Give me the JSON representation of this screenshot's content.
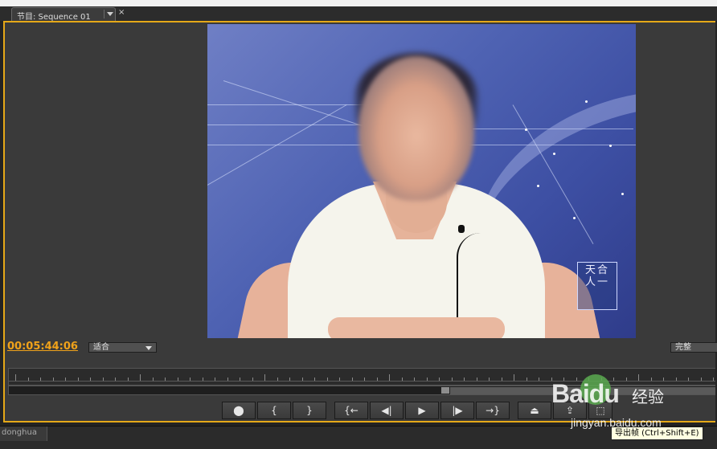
{
  "tab": {
    "title": "节目: Sequence 01",
    "close": "×"
  },
  "monitor": {
    "timecode": "00:05:44:06",
    "zoom_select": "适合",
    "quality_select": "完整",
    "video_logo_line1": "天合",
    "video_logo_line2": "人一"
  },
  "transport": {
    "buttons": [
      {
        "name": "add-marker-button",
        "glyph": "⬤"
      },
      {
        "name": "mark-in-button",
        "glyph": "{"
      },
      {
        "name": "mark-out-button",
        "glyph": "}"
      },
      {
        "name": "go-to-in-button",
        "glyph": "{←"
      },
      {
        "name": "step-back-button",
        "glyph": "◀|"
      },
      {
        "name": "play-button",
        "glyph": "▶"
      },
      {
        "name": "step-forward-button",
        "glyph": "|▶"
      },
      {
        "name": "go-to-out-button",
        "glyph": "→}"
      },
      {
        "name": "lift-button",
        "glyph": "⏏"
      },
      {
        "name": "extract-button",
        "glyph": "⇪"
      },
      {
        "name": "export-frame-button",
        "glyph": "⬚"
      }
    ]
  },
  "bottom": {
    "tab_label": "donghua"
  },
  "tooltip": "导出帧 (Ctrl+Shift+E)",
  "watermark": {
    "brand": "Baidu",
    "cn": "经验",
    "url": "jingyan.baidu.com"
  }
}
